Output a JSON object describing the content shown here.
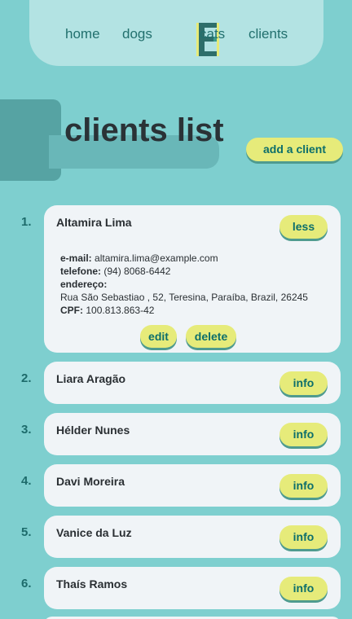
{
  "nav": {
    "links": [
      "home",
      "dogs",
      "cats",
      "clients"
    ],
    "logo_letter": "E"
  },
  "title": "clients list",
  "add_button": "add a client",
  "clients": [
    {
      "number": "1.",
      "name": "Altamira Lima",
      "toggle_label": "less",
      "expanded": true,
      "email_label": "e-mail:",
      "email": "altamira.lima@example.com",
      "phone_label": "telefone:",
      "phone": "(94) 8068-6442",
      "address_label": "endereço:",
      "address": "Rua São Sebastiao , 52, Teresina, Paraíba, Brazil, 26245",
      "cpf_label": "CPF:",
      "cpf": "100.813.863-42",
      "edit_label": "edit",
      "delete_label": "delete"
    },
    {
      "number": "2.",
      "name": "Liara Aragão",
      "toggle_label": "info"
    },
    {
      "number": "3.",
      "name": "Hélder Nunes",
      "toggle_label": "info"
    },
    {
      "number": "4.",
      "name": "Davi Moreira",
      "toggle_label": "info"
    },
    {
      "number": "5.",
      "name": "Vanice da Luz",
      "toggle_label": "info"
    },
    {
      "number": "6.",
      "name": "Thaís Ramos",
      "toggle_label": "info"
    }
  ],
  "colors": {
    "background": "#7ecfcf",
    "nav_bg": "#b3e3e3",
    "button_bg": "#e6eb7a",
    "button_text": "#0c6e6b",
    "card_bg": "#f0f4f7"
  }
}
